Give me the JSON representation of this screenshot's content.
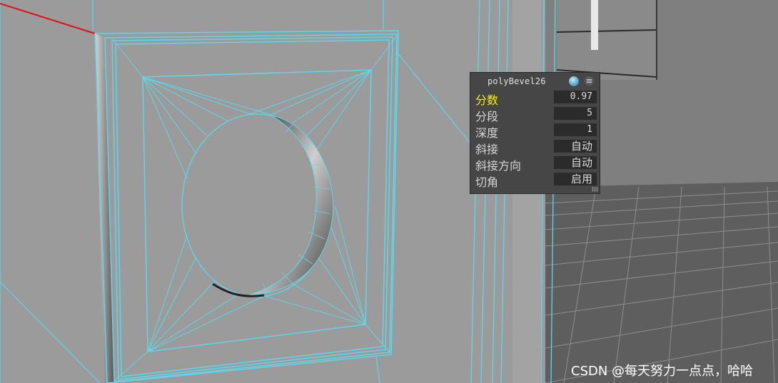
{
  "node_panel": {
    "title": "polyBevel26",
    "rows": [
      {
        "label": "分数",
        "value": "0.97"
      },
      {
        "label": "分段",
        "value": "5"
      },
      {
        "label": "深度",
        "value": "1"
      },
      {
        "label": "斜接",
        "value": "自动"
      },
      {
        "label": "斜接方向",
        "value": "自动"
      },
      {
        "label": "切角",
        "value": "启用"
      }
    ],
    "icons": {
      "settings": "sphere-shading-icon",
      "menu": "menu-icon"
    }
  },
  "watermark": "CSDN @每天努力一点点，哈哈",
  "colors": {
    "viewport_bg": "#9a9a9a",
    "wireframe": "#5fd6ea",
    "active_label": "#f2f200",
    "panel_bg": "#464646",
    "red_axis": "#e01010"
  }
}
